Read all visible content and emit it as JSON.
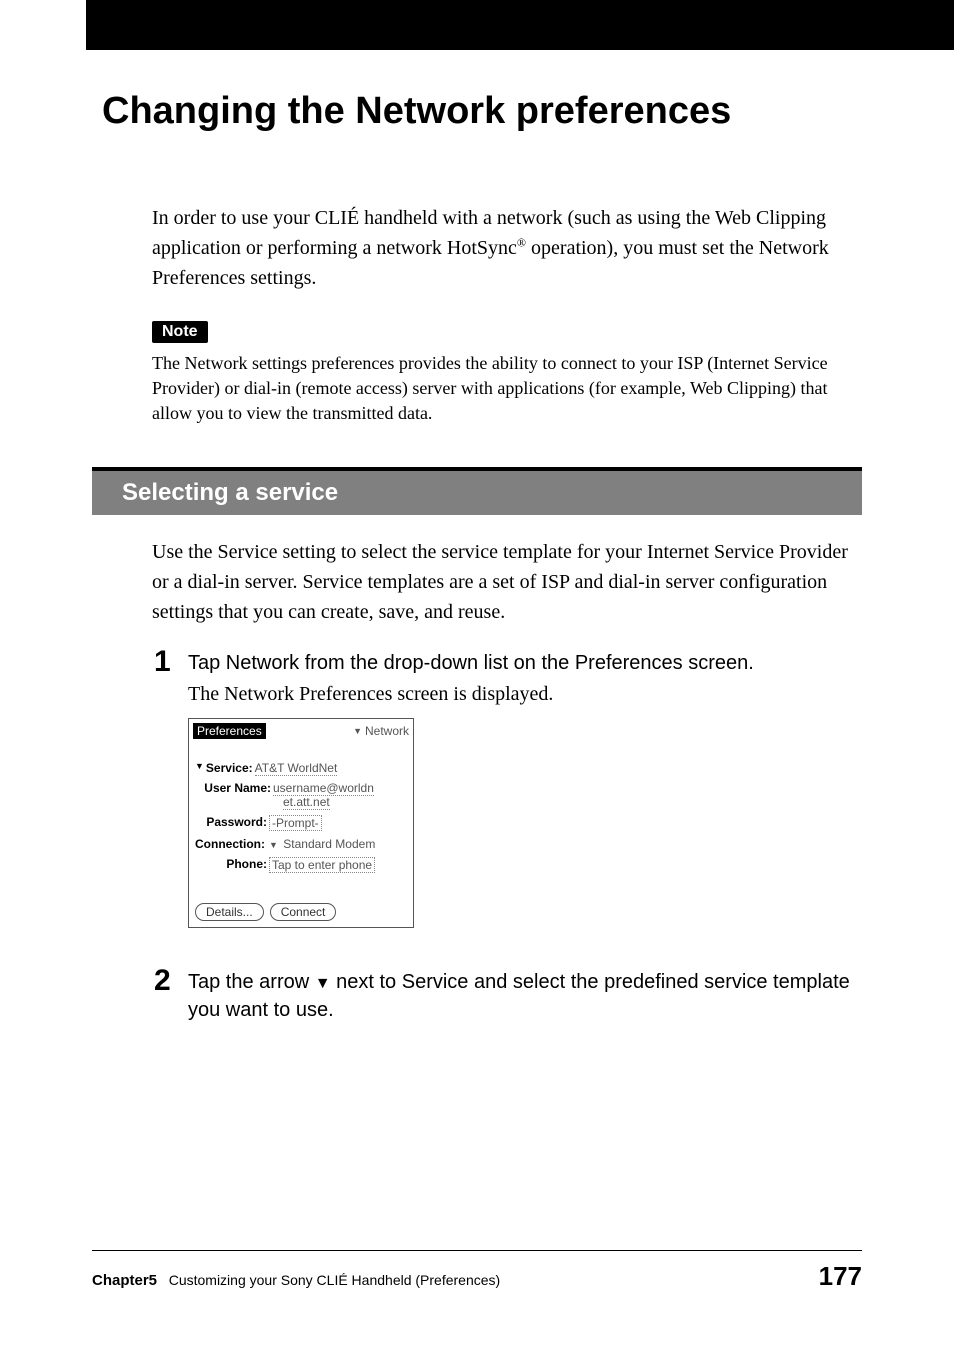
{
  "page_title": "Changing the Network preferences",
  "intro": {
    "line1a": "In order to use your CLIÉ handheld with a network (such as using the Web Clipping application or performing a network HotSync",
    "sup": "®",
    "line1b": " operation), you must set the Network Preferences settings."
  },
  "note_label": "Note",
  "note_text": "The Network settings preferences provides the ability to connect to your ISP (Internet Service Provider) or dial-in (remote access) server with applications (for example, Web Clipping) that allow you to view the transmitted data.",
  "section_heading": "Selecting a service",
  "section_intro": "Use the Service setting to select the service template for your Internet Service Provider or a dial-in server. Service templates are a set of ISP and dial-in server configuration settings that you can create, save, and reuse.",
  "steps": [
    {
      "num": "1",
      "text": "Tap Network from the drop-down list on the Preferences screen.",
      "sub": "The Network Preferences screen is displayed."
    },
    {
      "num": "2",
      "text_a": "Tap the arrow ",
      "arrow": "▼",
      "text_b": " next to Service and select the predefined service template you want to use."
    }
  ],
  "screenshot": {
    "title": "Preferences",
    "dropdown_value": "Network",
    "fields": {
      "service": {
        "label": "Service:",
        "value": "AT&T WorldNet"
      },
      "username": {
        "label": "User Name:",
        "value_line1": "username@worldn",
        "value_line2": "et.att.net"
      },
      "password": {
        "label": "Password:",
        "value": "-Prompt-"
      },
      "connection": {
        "label": "Connection:",
        "value": "Standard Modem"
      },
      "phone": {
        "label": "Phone:",
        "value": "Tap to enter phone"
      }
    },
    "buttons": {
      "details": "Details...",
      "connect": "Connect"
    }
  },
  "footer": {
    "chapter_label": "Chapter5",
    "chapter_title": "Customizing your Sony CLIÉ Handheld (Preferences)",
    "page_number": "177"
  }
}
